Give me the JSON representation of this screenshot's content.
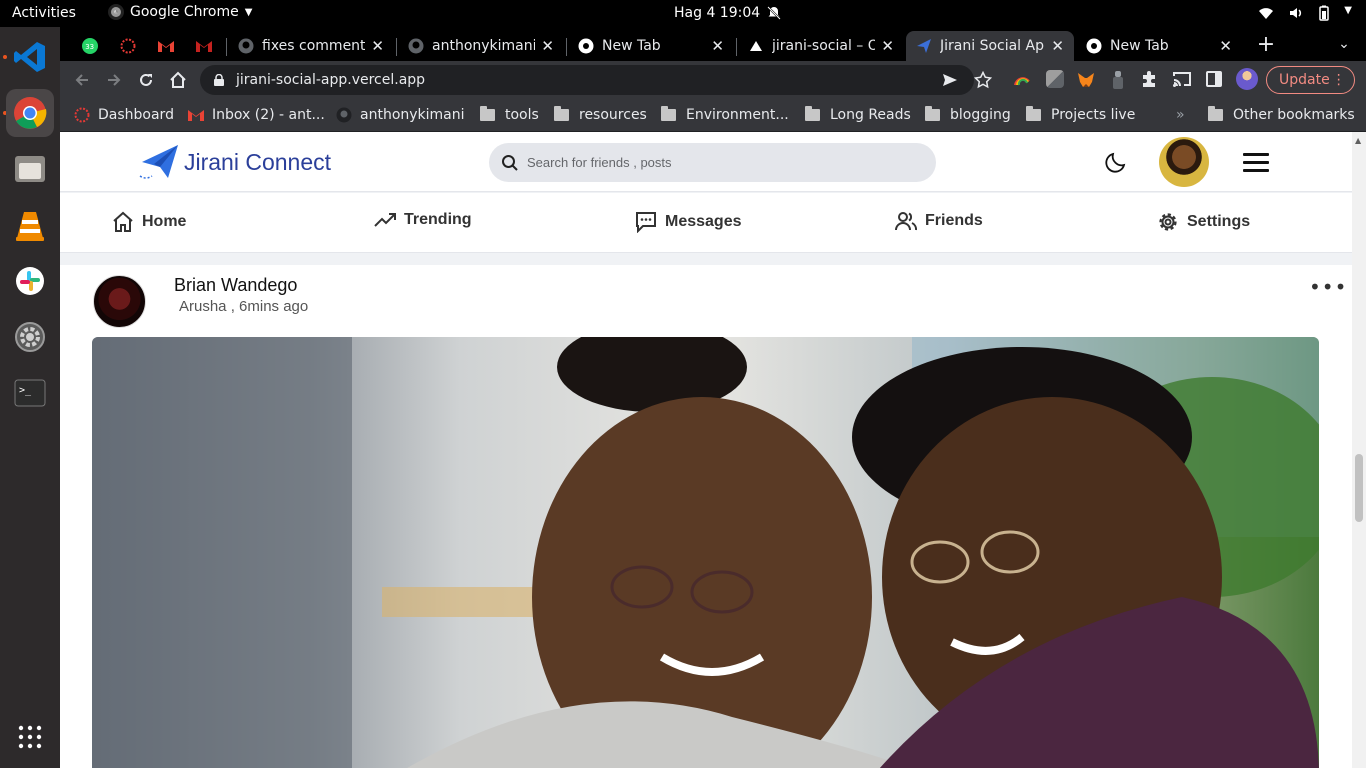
{
  "system": {
    "activities": "Activities",
    "app_name": "Google Chrome",
    "clock": "Hag 4  19:04"
  },
  "tabs": [
    {
      "title": "fixes comment t"
    },
    {
      "title": "anthonykimani"
    },
    {
      "title": "New Tab"
    },
    {
      "title": "jirani-social – O"
    },
    {
      "title": "Jirani Social Ap",
      "active": true
    },
    {
      "title": "New Tab"
    }
  ],
  "omnibox": {
    "url": "jirani-social-app.vercel.app"
  },
  "update_label": "Update",
  "bookmarks": [
    {
      "label": "Dashboard",
      "icon": "dashboard-icon"
    },
    {
      "label": "Inbox (2) - ant...",
      "icon": "gmail-icon"
    },
    {
      "label": "anthonykimani",
      "icon": "github-icon"
    },
    {
      "label": "tools",
      "icon": "folder-icon"
    },
    {
      "label": "resources",
      "icon": "folder-icon"
    },
    {
      "label": "Environment...",
      "icon": "folder-icon"
    },
    {
      "label": "Long Reads",
      "icon": "folder-icon"
    },
    {
      "label": "blogging",
      "icon": "folder-icon"
    },
    {
      "label": "Projects live",
      "icon": "folder-icon"
    }
  ],
  "bookmarks_overflow": "»",
  "other_bookmarks": "Other bookmarks",
  "app": {
    "brand": "Jirani Connect",
    "search_placeholder": "Search for friends , posts",
    "nav": [
      {
        "label": "Home",
        "icon": "home-icon"
      },
      {
        "label": "Trending",
        "icon": "trending-icon"
      },
      {
        "label": "Messages",
        "icon": "messages-icon"
      },
      {
        "label": "Friends",
        "icon": "friends-icon"
      },
      {
        "label": "Settings",
        "icon": "settings-icon"
      }
    ]
  },
  "post": {
    "author": "Brian Wandego",
    "meta": "Arusha , 6mins ago",
    "more": "•••"
  },
  "colors": {
    "brand": "#2b3f9a",
    "update_red": "#f28b82",
    "ubuntu_orange": "#e95420"
  }
}
